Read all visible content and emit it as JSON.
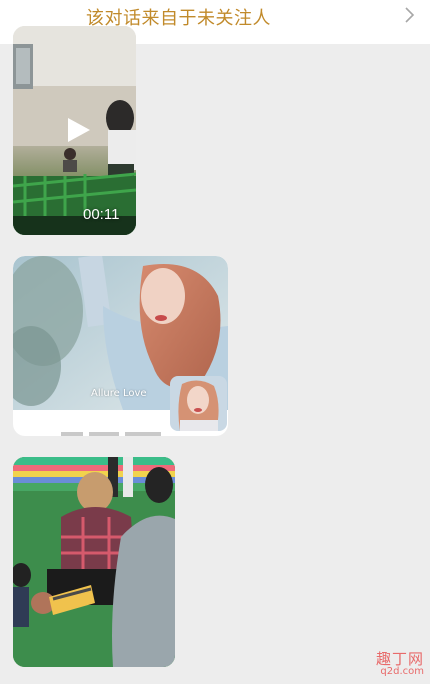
{
  "notice": {
    "text": "该对话来自于未关注人",
    "chevron_icon": "chevron-right-icon"
  },
  "messages": [
    {
      "kind": "video",
      "duration": "00:11",
      "icon": "play-icon"
    },
    {
      "kind": "image",
      "caption": "Allure Love"
    },
    {
      "kind": "image"
    }
  ],
  "watermark": {
    "title": "趣丁网",
    "url": "q2d.com"
  },
  "colors": {
    "background": "#ededed",
    "notice_text": "#c18a2a",
    "watermark": "#e86a6a"
  }
}
